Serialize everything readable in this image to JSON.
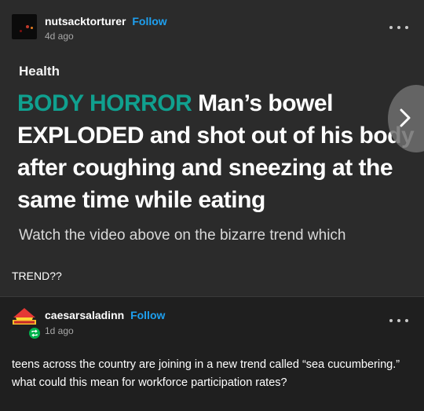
{
  "post1": {
    "username": "nutsacktorturer",
    "follow_label": "Follow",
    "time": "4d ago",
    "image": {
      "category": "Health",
      "headline_tag": "BODY HORROR",
      "headline_text": "Man’s bowel EXPLODED and shot out of his body after coughing and sneezing at the same time while eating",
      "subline": "Watch the video above on the bizarre trend which"
    },
    "caption": "TREND??"
  },
  "post2": {
    "username": "caesarsaladinn",
    "follow_label": "Follow",
    "time": "1d ago",
    "caption": "teens across the country are joining in a new trend called “sea cucumbering.” what could this mean for workforce participation rates?"
  },
  "icons": {
    "more": "more-options-icon",
    "next": "chevron-right-icon",
    "reblog": "reblog-icon"
  },
  "colors": {
    "follow": "#1ea0f0",
    "headline_tag": "#10a08f",
    "reblog_badge": "#00b34d"
  }
}
